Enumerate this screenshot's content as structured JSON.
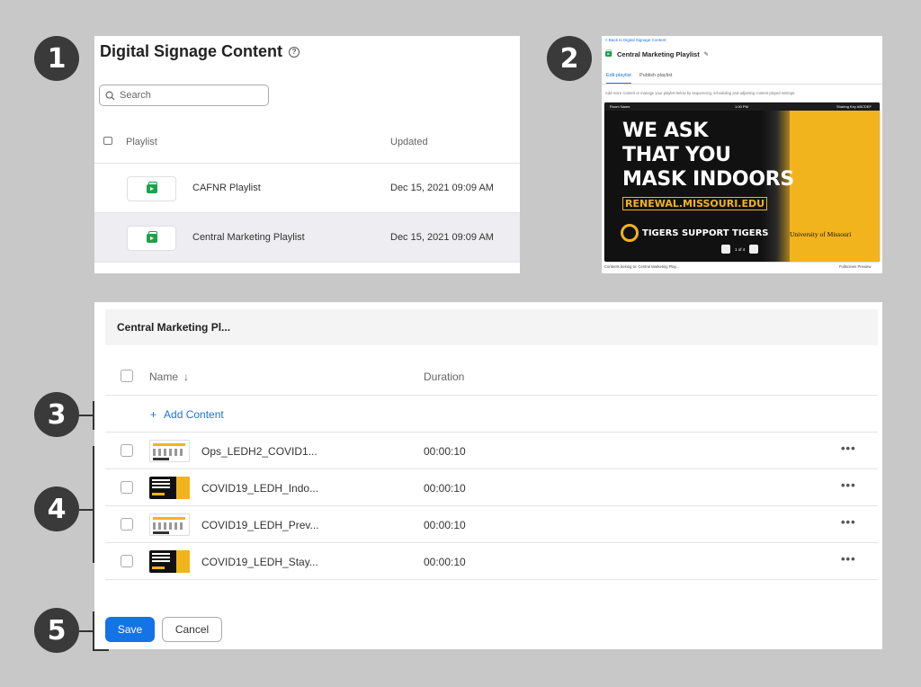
{
  "badges": [
    "1",
    "2",
    "3",
    "4",
    "5"
  ],
  "panel1": {
    "title": "Digital Signage Content",
    "help_icon": "question-circle-icon",
    "search": {
      "placeholder": "Search"
    },
    "columns": {
      "playlist": "Playlist",
      "updated": "Updated"
    },
    "rows": [
      {
        "name": "CAFNR Playlist",
        "updated": "Dec 15, 2021 09:09 AM",
        "selected": false
      },
      {
        "name": "Central Marketing Playlist",
        "updated": "Dec 15, 2021 09:09 AM",
        "selected": true
      }
    ]
  },
  "panel2": {
    "back_link": "< Back to Digital Signage Content",
    "title": "Central Marketing Playlist",
    "tabs": [
      "Edit playlist",
      "Publish playlist"
    ],
    "description": "Add more content or manage your playlist below by sequencing, scheduling and adjusting content played settings.",
    "preview": {
      "room_name": "Room Name",
      "time": "1:00 PM",
      "sharing_key": "Sharing Key ABCDEF",
      "headline": [
        "WE ASK",
        "THAT YOU",
        "MASK INDOORS"
      ],
      "url": "RENEWAL.MISSOURI.EDU",
      "slogan": "TIGERS SUPPORT TIGERS",
      "university": "University of Missouri",
      "pager": "1 of 4"
    },
    "footer_left": "Contents belong to: Central Marketing Play...",
    "footer_right": "Fullscreen Preview"
  },
  "panel3": {
    "header": "Central Marketing Pl...",
    "columns": {
      "name": "Name",
      "duration": "Duration"
    },
    "add_content": "Add Content",
    "rows": [
      {
        "name": "Ops_LEDH2_COVID1...",
        "duration": "00:00:10",
        "thumb": "light"
      },
      {
        "name": "COVID19_LEDH_Indo...",
        "duration": "00:00:10",
        "thumb": "dark"
      },
      {
        "name": "COVID19_LEDH_Prev...",
        "duration": "00:00:10",
        "thumb": "light"
      },
      {
        "name": "COVID19_LEDH_Stay...",
        "duration": "00:00:10",
        "thumb": "dark"
      }
    ],
    "more_label": "•••",
    "save": "Save",
    "cancel": "Cancel"
  },
  "colors": {
    "accent": "#1473e6",
    "brand_yellow": "#f2b41c",
    "playlist_green": "#1aa34a",
    "badge": "#3a3a3a"
  }
}
